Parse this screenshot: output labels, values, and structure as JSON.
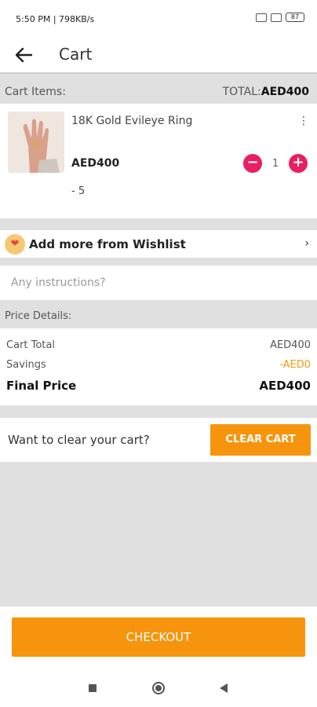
{
  "status_bar": {
    "time": "5:50 PM | 798KB/s",
    "battery": "87"
  },
  "app_bar": {
    "title": "Cart",
    "back_icon": "arrow-left-icon"
  },
  "cart_header": {
    "label": "Cart Items:",
    "total_label": "TOTAL:",
    "total_value": "AED400"
  },
  "cart_items": [
    {
      "name": "18K Gold Evileye Ring",
      "price": "AED400",
      "quantity": "1",
      "discount": "- 5",
      "minus": "−",
      "plus": "+",
      "more": "⋮"
    }
  ],
  "wishlist": {
    "label": "Add more from Wishlist",
    "chevron": "›"
  },
  "instructions": {
    "placeholder": "Any instructions?"
  },
  "price_details": {
    "heading": "Price Details:",
    "cart_total_label": "Cart Total",
    "cart_total_value": "AED400",
    "savings_label": "Savings",
    "savings_value": "-AED0",
    "final_label": "Final Price",
    "final_value": "AED400"
  },
  "clear_cart": {
    "prompt": "Want to clear your cart?",
    "button": "CLEAR CART"
  },
  "checkout": {
    "button": "CHECKOUT"
  },
  "colors": {
    "accent": "#f7940d",
    "stepper": "#e91e63",
    "savings": "#f39c12"
  }
}
